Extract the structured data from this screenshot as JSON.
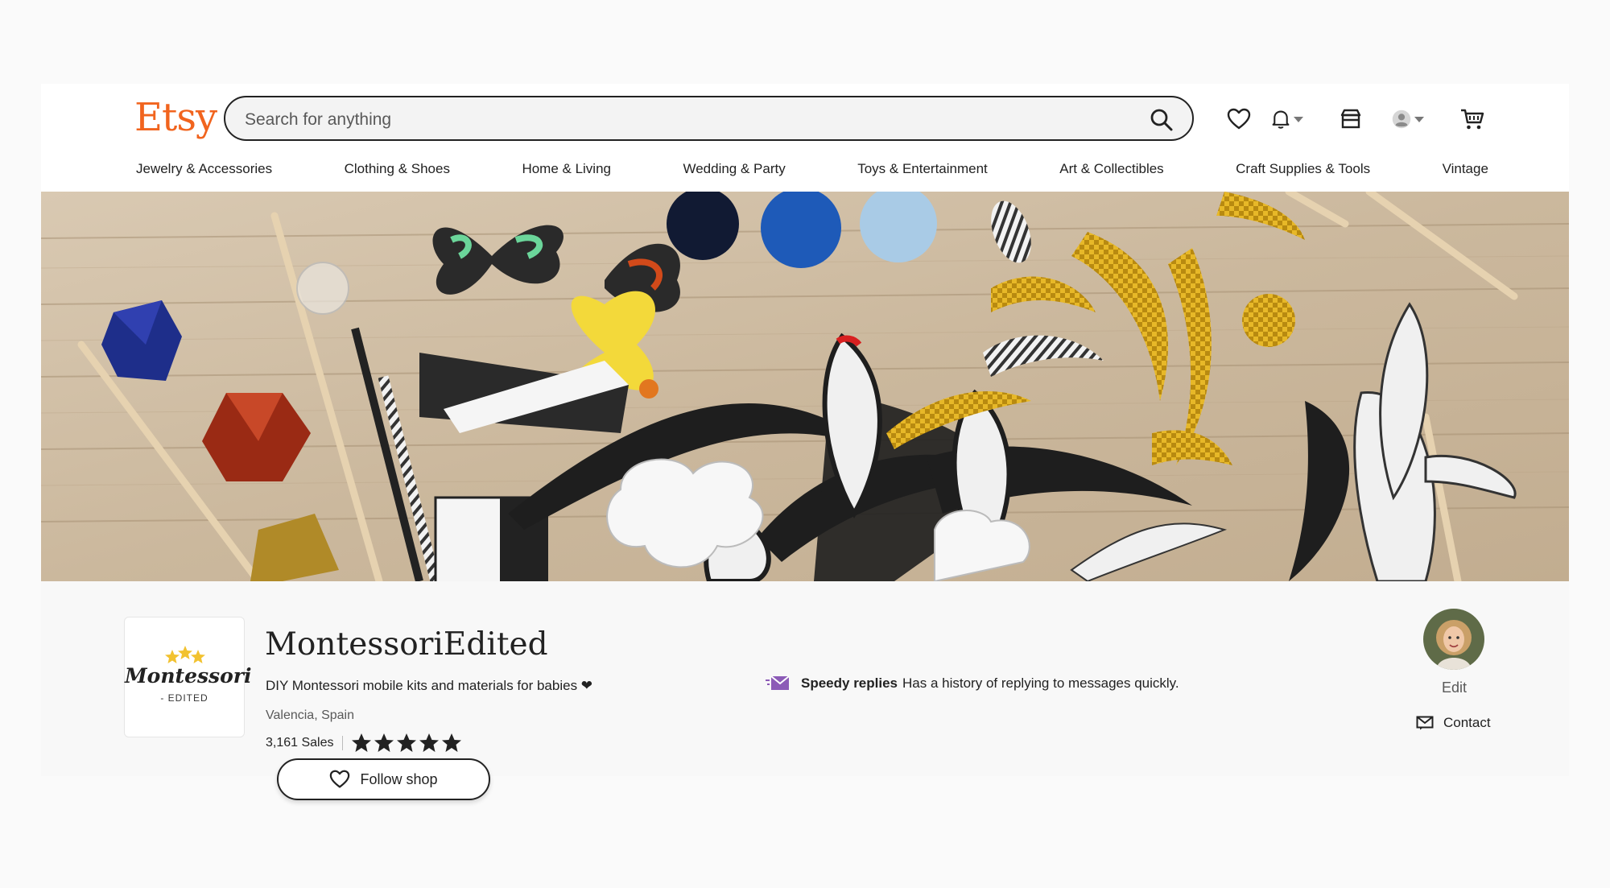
{
  "header": {
    "logo": "Etsy",
    "search_placeholder": "Search for anything",
    "categories": [
      "Jewelry & Accessories",
      "Clothing & Shoes",
      "Home & Living",
      "Wedding & Party",
      "Toys & Entertainment",
      "Art & Collectibles",
      "Craft Supplies & Tools",
      "Vintage"
    ],
    "icons": [
      "heart-icon",
      "bell-icon",
      "shop-manager-icon",
      "account-avatar-icon",
      "cart-icon"
    ]
  },
  "shop": {
    "logo_top": "Montessori",
    "logo_bottom": "- EDITED",
    "name": "MontessoriEdited",
    "tagline": "DIY Montessori mobile kits and materials for babies ❤",
    "location": "Valencia, Spain",
    "sales": "3,161 Sales",
    "rating": 5,
    "rating_max": 5,
    "follow_label": "Follow shop",
    "speedy_title": "Speedy replies",
    "speedy_text": "Has a history of replying to messages quickly.",
    "edit_label": "Edit",
    "contact_label": "Contact"
  },
  "colors": {
    "brand": "#f1641e",
    "speedy_icon": "#8c5bb7",
    "text": "#222222",
    "muted": "#595959"
  }
}
